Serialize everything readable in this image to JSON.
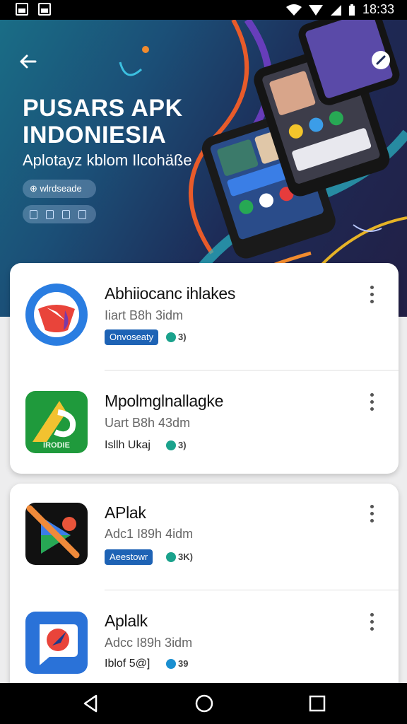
{
  "status_bar": {
    "time": "18:33"
  },
  "hero": {
    "title": "PUSARS APK INDONIESIA",
    "subtitle": "Aplotayz kblom Ilcohäße",
    "pill_label": "⊕ wlrdseade"
  },
  "apps": [
    {
      "name": "Abhiiocanc ihlakes",
      "meta": "Iiart B8h 3idm",
      "tag": "Onvoseaty",
      "tag_style": "badge",
      "extra": "3)",
      "icon": "compass-red-icon"
    },
    {
      "name": "Mpolmglnallagke",
      "meta": "Uart B8h 43dm",
      "tag": "Isllh Ukaj",
      "tag_style": "plain",
      "extra": "3)",
      "icon": "green-a-icon",
      "icon_text": "IRODIE"
    },
    {
      "name": "APlak",
      "meta": "Adc1 I89h 4idm",
      "tag": "Aeestowr",
      "tag_style": "badge",
      "extra": "3K)",
      "icon": "play-slash-icon"
    },
    {
      "name": "Aplalk",
      "meta": "Adcc I89h 3idm",
      "tag": "Iblof 5@]",
      "tag_style": "plain",
      "extra": "39",
      "icon": "chat-compass-icon"
    }
  ],
  "colors": {
    "accent": "#1e63b5",
    "hero_start": "#1a6d86",
    "hero_end": "#221f45"
  }
}
